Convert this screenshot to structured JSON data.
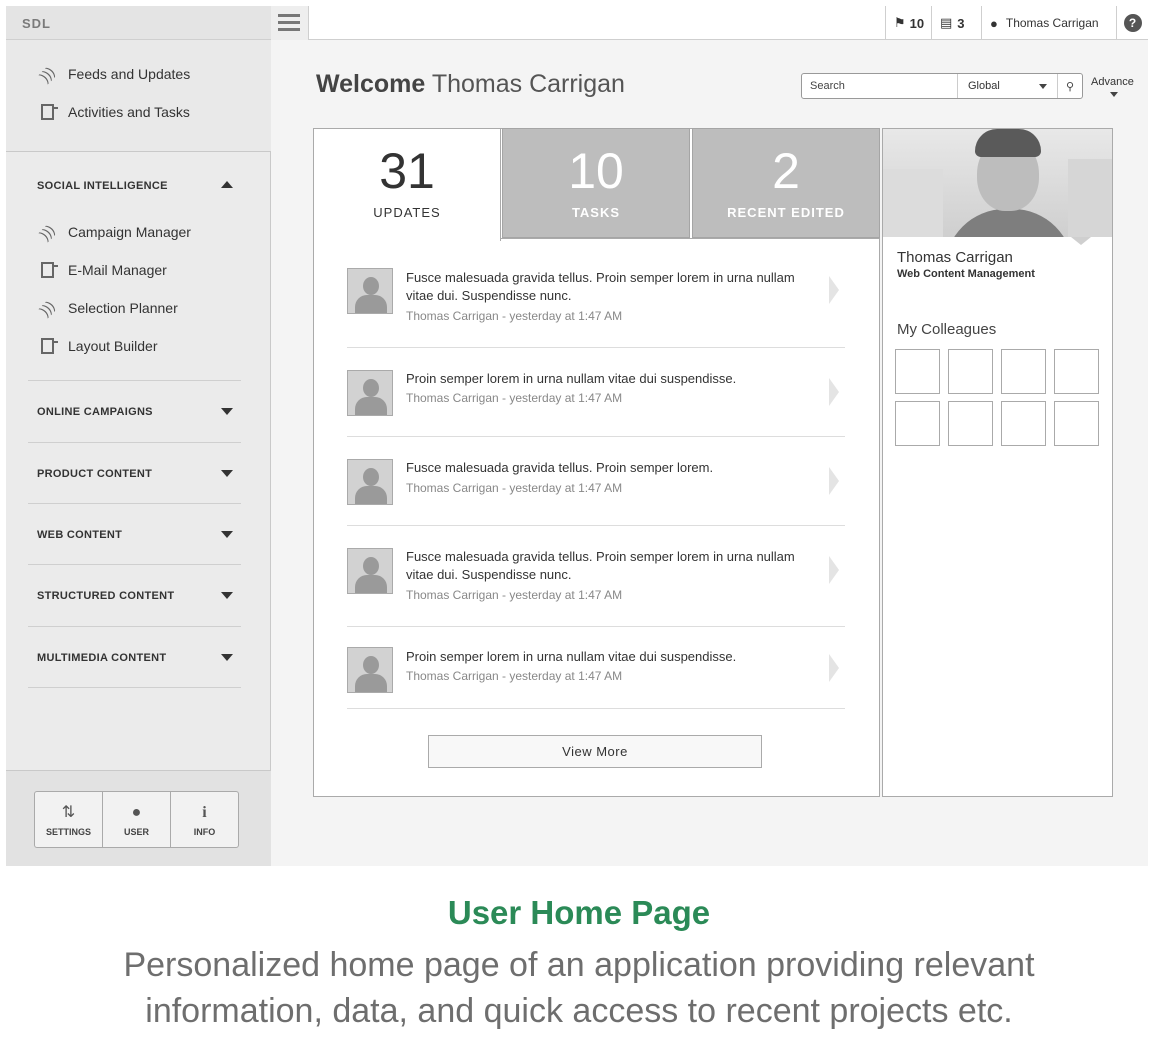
{
  "app": {
    "logo": "SDL",
    "topbar": {
      "flags_count": "10",
      "tasks_count": "3",
      "user_name": "Thomas Carrigan",
      "help": "?"
    }
  },
  "sidebar": {
    "top_items": [
      {
        "label": "Feeds and Updates",
        "icon": "rss-icon"
      },
      {
        "label": "Activities and Tasks",
        "icon": "document-icon"
      }
    ],
    "social_section": {
      "title": "SOCIAL INTELLIGENCE",
      "items": [
        {
          "label": "Campaign Manager",
          "icon": "rss-icon"
        },
        {
          "label": "E-Mail Manager",
          "icon": "document-icon"
        },
        {
          "label": "Selection Planner",
          "icon": "rss-icon"
        },
        {
          "label": "Layout Builder",
          "icon": "document-icon"
        }
      ]
    },
    "sections": [
      {
        "title": "ONLINE CAMPAIGNS"
      },
      {
        "title": "PRODUCT CONTENT"
      },
      {
        "title": "WEB CONTENT"
      },
      {
        "title": "STRUCTURED CONTENT"
      },
      {
        "title": "MULTIMEDIA CONTENT"
      }
    ],
    "tools": [
      {
        "label": "SETTINGS",
        "icon": "sliders-icon"
      },
      {
        "label": "USER",
        "icon": "user-icon"
      },
      {
        "label": "INFO",
        "icon": "info-icon"
      }
    ]
  },
  "main": {
    "welcome_bold": "Welcome",
    "welcome_name": "Thomas Carrigan",
    "search": {
      "placeholder": "Search",
      "scope": "Global",
      "advance": "Advance"
    },
    "tabs": [
      {
        "count": "31",
        "label": "UPDATES"
      },
      {
        "count": "10",
        "label": "TASKS"
      },
      {
        "count": "2",
        "label": "RECENT EDITED"
      }
    ],
    "feed": [
      {
        "text": "Fusce malesuada gravida tellus. Proin semper lorem in urna nullam vitae dui. Suspendisse nunc.",
        "meta": "Thomas Carrigan - yesterday at 1:47 AM"
      },
      {
        "text": "Proin semper lorem in urna nullam vitae dui suspendisse.",
        "meta": "Thomas Carrigan - yesterday at 1:47 AM"
      },
      {
        "text": "Fusce malesuada gravida tellus. Proin semper lorem.",
        "meta": "Thomas Carrigan - yesterday at 1:47 AM"
      },
      {
        "text": "Fusce malesuada gravida tellus. Proin semper lorem in urna nullam vitae dui. Suspendisse nunc.",
        "meta": "Thomas Carrigan - yesterday at 1:47 AM"
      },
      {
        "text": "Proin semper lorem in urna nullam vitae dui suspendisse.",
        "meta": "Thomas Carrigan - yesterday at 1:47 AM"
      }
    ],
    "view_more": "View More"
  },
  "profile": {
    "name": "Thomas Carrigan",
    "role": "Web Content Management",
    "colleagues_title": "My Colleagues"
  },
  "caption": {
    "title": "User Home Page",
    "description": "Personalized home page of an application providing relevant information, data, and quick access to recent projects etc."
  },
  "colors": {
    "caption_title": "#2b8a57",
    "tab_grey": "#bdbdbd"
  }
}
